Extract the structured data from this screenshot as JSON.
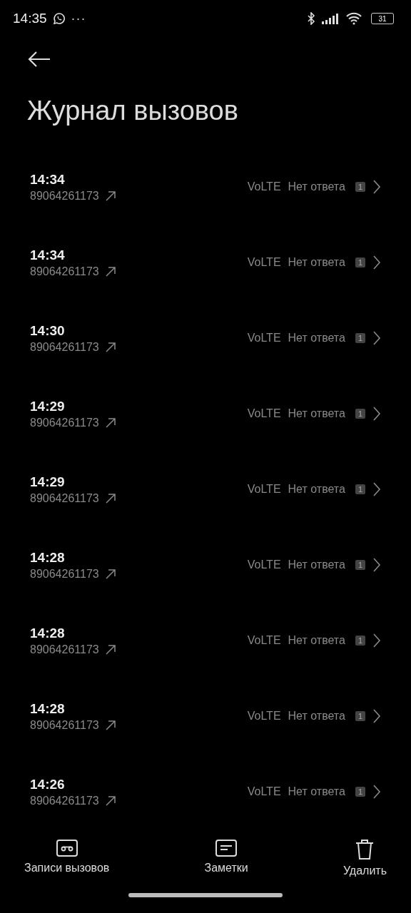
{
  "status_bar": {
    "time": "14:35",
    "more": "···",
    "battery": "31"
  },
  "header": {
    "title": "Журнал вызовов"
  },
  "calls": [
    {
      "time": "14:34",
      "number": "89064261173",
      "network": "VoLTE",
      "status": "Нет ответа",
      "sim": "1"
    },
    {
      "time": "14:34",
      "number": "89064261173",
      "network": "VoLTE",
      "status": "Нет ответа",
      "sim": "1"
    },
    {
      "time": "14:30",
      "number": "89064261173",
      "network": "VoLTE",
      "status": "Нет ответа",
      "sim": "1"
    },
    {
      "time": "14:29",
      "number": "89064261173",
      "network": "VoLTE",
      "status": "Нет ответа",
      "sim": "1"
    },
    {
      "time": "14:29",
      "number": "89064261173",
      "network": "VoLTE",
      "status": "Нет ответа",
      "sim": "1"
    },
    {
      "time": "14:28",
      "number": "89064261173",
      "network": "VoLTE",
      "status": "Нет ответа",
      "sim": "1"
    },
    {
      "time": "14:28",
      "number": "89064261173",
      "network": "VoLTE",
      "status": "Нет ответа",
      "sim": "1"
    },
    {
      "time": "14:28",
      "number": "89064261173",
      "network": "VoLTE",
      "status": "Нет ответа",
      "sim": "1"
    },
    {
      "time": "14:26",
      "number": "89064261173",
      "network": "VoLTE",
      "status": "Нет ответа",
      "sim": "1"
    }
  ],
  "bottom_actions": [
    {
      "kind": "recordings",
      "label": "Записи вызовов"
    },
    {
      "kind": "notes",
      "label": "Заметки"
    },
    {
      "kind": "delete",
      "label": "Удалить"
    }
  ]
}
